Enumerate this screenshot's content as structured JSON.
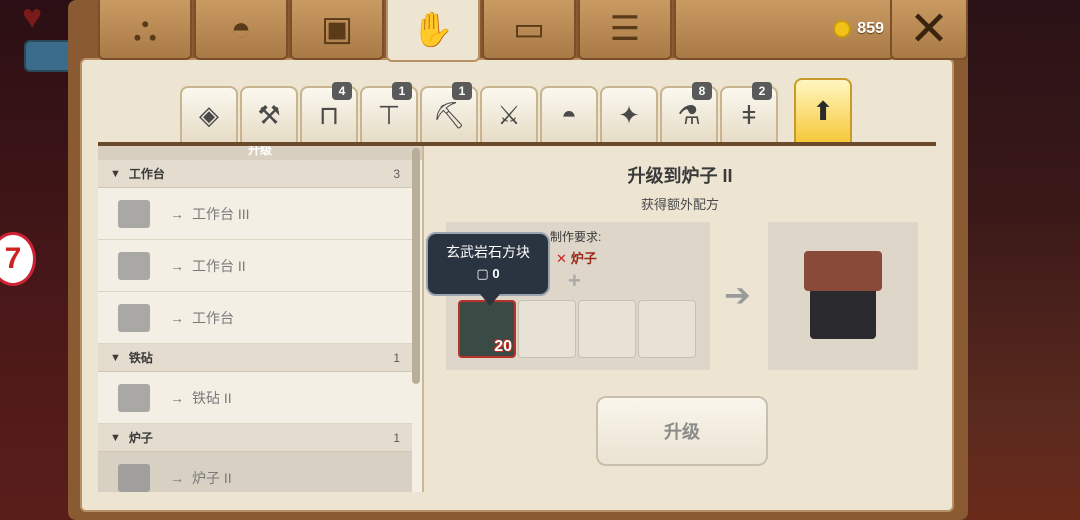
{
  "hud": {
    "level_badge": "7"
  },
  "topbar": {
    "tabs": [
      {
        "icon": "tech-tree-icon"
      },
      {
        "icon": "helmet-icon"
      },
      {
        "icon": "chest-icon"
      },
      {
        "icon": "crafting-hand-icon",
        "active": true
      },
      {
        "icon": "book-icon"
      },
      {
        "icon": "scroll-icon"
      }
    ],
    "coins": "859",
    "close_icon": "close-icon"
  },
  "subtabs": [
    {
      "icon": "block-icon",
      "badge": ""
    },
    {
      "icon": "tools-icon",
      "badge": ""
    },
    {
      "icon": "workbench-icon",
      "badge": "4"
    },
    {
      "icon": "table-icon",
      "badge": "1"
    },
    {
      "icon": "pickaxe-icon",
      "badge": "1"
    },
    {
      "icon": "sword-icon",
      "badge": ""
    },
    {
      "icon": "helmet-icon",
      "badge": ""
    },
    {
      "icon": "sparkle-icon",
      "badge": ""
    },
    {
      "icon": "potion-icon",
      "badge": "8"
    },
    {
      "icon": "torch-icon",
      "badge": "2"
    },
    {
      "icon": "upgrade-arrow-icon",
      "badge": "",
      "active": true
    }
  ],
  "list": {
    "header": "升级",
    "categories": [
      {
        "name": "工作台",
        "count": "3",
        "items": [
          "工作台 III",
          "工作台 II",
          "工作台"
        ]
      },
      {
        "name": "铁砧",
        "count": "1",
        "items": [
          "铁砧 II"
        ]
      },
      {
        "name": "炉子",
        "count": "1",
        "items": [
          "炉子 II"
        ]
      }
    ]
  },
  "detail": {
    "title": "升级到炉子 II",
    "subtitle": "获得额外配方",
    "requirements_label": "制作要求:",
    "requirement_item": "炉子",
    "slot_count": "20",
    "tooltip_name": "玄武岩石方块",
    "tooltip_qty": "0",
    "upgrade_button": "升级"
  }
}
